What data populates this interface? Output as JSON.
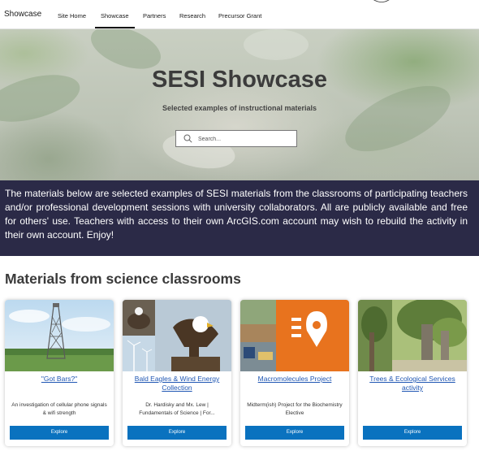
{
  "nav": {
    "brand": "Showcase",
    "links": [
      "Site Home",
      "Showcase",
      "Partners",
      "Research",
      "Precursor Grant"
    ],
    "active": "Showcase"
  },
  "hero": {
    "title": "SESI Showcase",
    "subtitle": "Selected examples of instructional materials",
    "search_placeholder": "Search...",
    "search_icon": "search-icon"
  },
  "intro": {
    "text": "The materials below are selected examples of SESI materials from the classrooms of participating teachers and/or professional development sessions with university collaborators. All are publicly available and free for others' use. Teachers with access to their own ArcGIS.com account may wish to rebuild the activity in their own account. Enjoy!"
  },
  "section": {
    "title": "Materials from science classrooms"
  },
  "cards": [
    {
      "title": "\"Got Bars?\"",
      "description": "An investigation of cellular phone signals & wifi strength",
      "button": "Explore"
    },
    {
      "title": "Bald Eagles & Wind Energy Collection",
      "description": "Dr. Hardisky and Mx. Lew | Fundamentals of Science | For...",
      "button": "Explore"
    },
    {
      "title": "Macromolecules Project",
      "description": "Midterm(ish) Project for the Biochemistry Elective",
      "button": "Explore"
    },
    {
      "title": "Trees & Ecological Services activity",
      "description": "",
      "button": "Explore"
    }
  ],
  "colors": {
    "intro_band": "#2b2a47",
    "button": "#0a72bf",
    "link": "#1f56b3",
    "map_tile_accent": "#e8731e"
  }
}
